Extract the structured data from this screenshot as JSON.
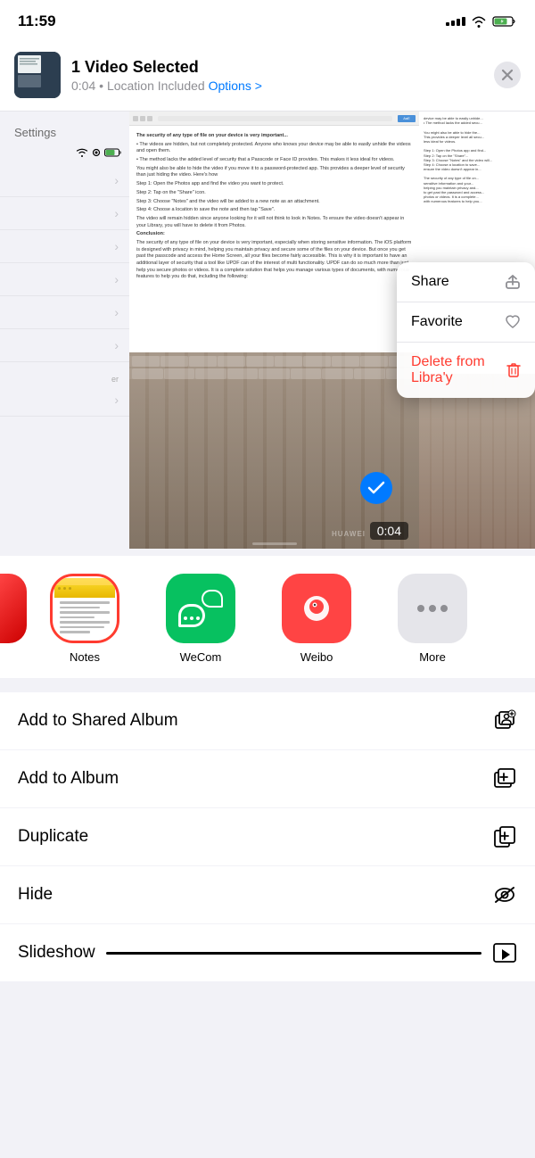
{
  "statusBar": {
    "time": "11:59",
    "signalBars": [
      3,
      5,
      7,
      9,
      11
    ],
    "wifiStrength": 3,
    "batteryLevel": 65,
    "charging": true
  },
  "shareHeader": {
    "title": "1 Video Selected",
    "duration": "0:04",
    "location": "Location Included",
    "optionsLabel": "Options >",
    "closeLabel": "×"
  },
  "videoPlayer": {
    "duration": "0:04",
    "settingsLabel": "Settings"
  },
  "contextMenu": {
    "items": [
      {
        "label": "Share",
        "iconType": "share"
      },
      {
        "label": "Favorite",
        "iconType": "heart"
      },
      {
        "label": "Delete from Libra'y",
        "iconType": "trash",
        "isDestructive": true
      }
    ]
  },
  "appRow": {
    "items": [
      {
        "id": "notes",
        "label": "Notes",
        "selected": true
      },
      {
        "id": "wecom",
        "label": "WeCom",
        "selected": false
      },
      {
        "id": "weibo",
        "label": "Weibo",
        "selected": false
      },
      {
        "id": "more",
        "label": "More",
        "selected": false
      }
    ]
  },
  "actionList": {
    "items": [
      {
        "id": "add-shared-album",
        "label": "Add to Shared Album",
        "icon": "shared-album"
      },
      {
        "id": "add-album",
        "label": "Add to Album",
        "icon": "album"
      },
      {
        "id": "duplicate",
        "label": "Duplicate",
        "icon": "duplicate"
      },
      {
        "id": "hide",
        "label": "Hide",
        "icon": "hide"
      }
    ]
  },
  "slideshow": {
    "label": "Slideshow"
  }
}
